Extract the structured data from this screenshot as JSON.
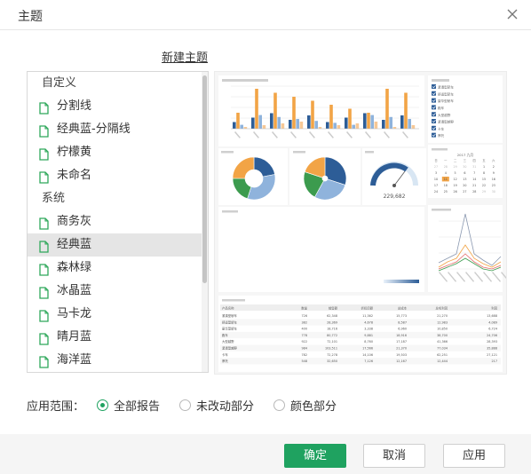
{
  "dialog": {
    "title": "主题"
  },
  "new_theme_label": "新建主题",
  "theme_list": {
    "groups": [
      {
        "label": "自定义",
        "items": [
          {
            "label": "分割线"
          },
          {
            "label": "经典蓝-分隔线"
          },
          {
            "label": "柠檬黄"
          },
          {
            "label": "未命名"
          }
        ]
      },
      {
        "label": "系统",
        "items": [
          {
            "label": "商务灰"
          },
          {
            "label": "经典蓝",
            "selected": true
          },
          {
            "label": "森林绿"
          },
          {
            "label": "冰晶蓝"
          },
          {
            "label": "马卡龙"
          },
          {
            "label": "晴月蓝"
          },
          {
            "label": "海洋蓝"
          }
        ]
      }
    ]
  },
  "preview": {
    "colors": [
      "#2d5d97",
      "#f2a446",
      "#8fb3dc",
      "#3c9b4e",
      "#a7c4e3"
    ],
    "gauge_value": "229,682",
    "calendar_title": "2017 九月",
    "calendar_weekdays": [
      "日",
      "一",
      "二",
      "三",
      "四",
      "五",
      "六"
    ],
    "calendar_days": [
      "27",
      "28",
      "29",
      "30",
      "31",
      "1",
      "2",
      "3",
      "4",
      "5",
      "6",
      "7",
      "8",
      "9",
      "10",
      "11",
      "12",
      "13",
      "14",
      "15",
      "16",
      "17",
      "18",
      "19",
      "20",
      "21",
      "22",
      "23",
      "24",
      "25",
      "26",
      "27",
      "28",
      "29",
      "30"
    ],
    "table_headers": [
      "产品名称",
      "数量",
      "销售额",
      "折扣后额",
      "总成本",
      "总毛利润",
      "利润"
    ],
    "table_rows": [
      [
        "紧凑型轿车",
        "726",
        "62,348",
        "11,362",
        "15,773",
        "21,270",
        "13,688"
      ],
      [
        "舒适型轿车",
        "382",
        "28,369",
        "4,678",
        "8,587",
        "12,983",
        "4,089"
      ],
      [
        "豪华型轿车",
        "400",
        "18,716",
        "3,338",
        "6,960",
        "10,850",
        "6,724"
      ],
      [
        "跑车",
        "778",
        "80,772",
        "9,881",
        "18,916",
        "38,700",
        "24,706"
      ],
      [
        "大型越野",
        "922",
        "72,101",
        "8,760",
        "17,187",
        "41,366",
        "28,393"
      ],
      [
        "紧凑型越野",
        "984",
        "103,511",
        "17,566",
        "21,370",
        "77,034",
        "35,888"
      ],
      [
        "卡车",
        "782",
        "72,278",
        "14,106",
        "19,503",
        "62,251",
        "27,121"
      ],
      [
        "摩托",
        "548",
        "32,650",
        "7,126",
        "12,167",
        "12,444",
        "217"
      ]
    ],
    "legend_items": [
      "紧凑型轿车",
      "舒适型轿车",
      "豪华型轿车",
      "跑车",
      "大型越野",
      "紧凑型越野",
      "卡车",
      "摩托"
    ]
  },
  "scope": {
    "label": "应用范围：",
    "options": [
      {
        "label": "全部报告",
        "checked": true
      },
      {
        "label": "未改动部分",
        "checked": false
      },
      {
        "label": "颜色部分",
        "checked": false
      }
    ]
  },
  "buttons": {
    "ok": "确定",
    "cancel": "取消",
    "apply": "应用"
  }
}
